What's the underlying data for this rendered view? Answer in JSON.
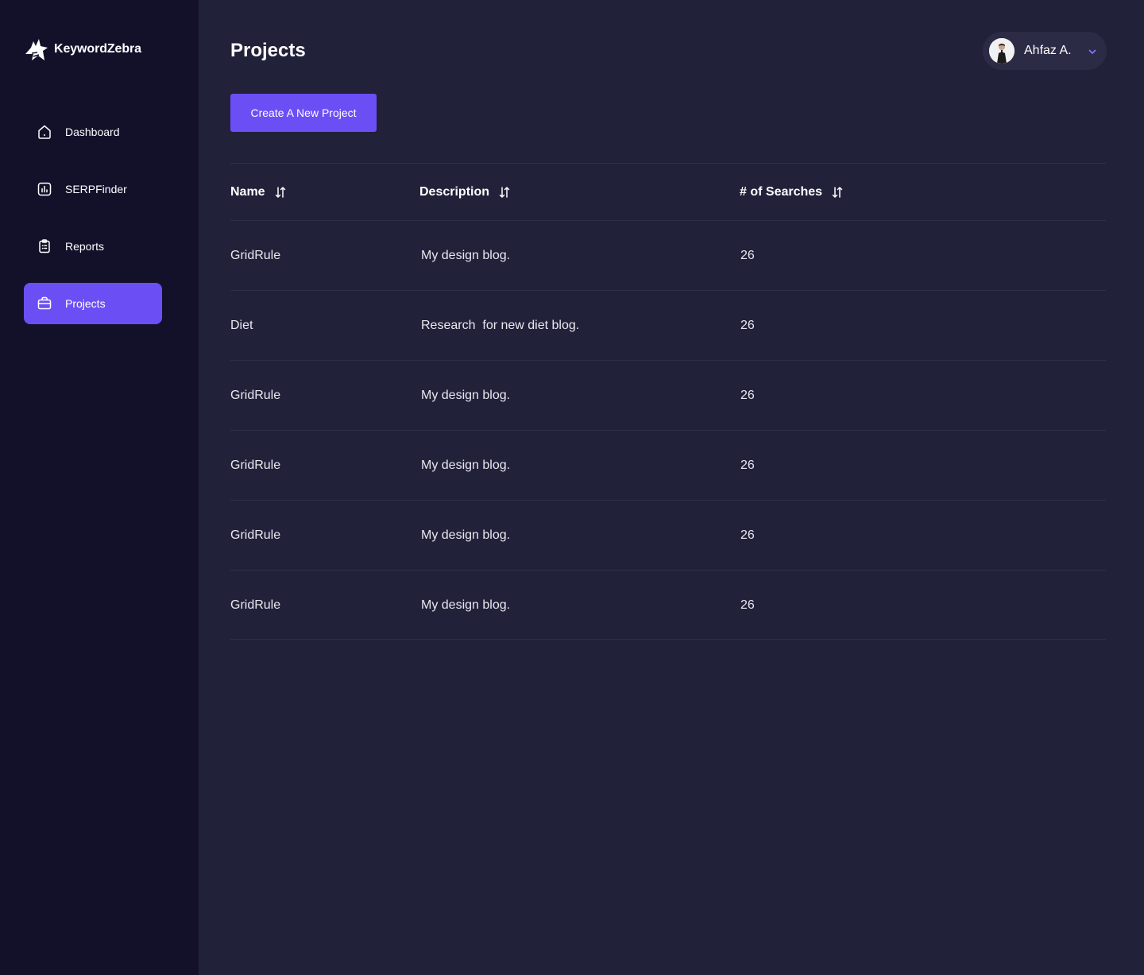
{
  "app": {
    "brand": "KeywordZebra"
  },
  "sidebar": {
    "items": [
      {
        "label": "Dashboard",
        "icon": "home-icon",
        "active": false
      },
      {
        "label": "SERPFinder",
        "icon": "bar-chart-icon",
        "active": false
      },
      {
        "label": "Reports",
        "icon": "clipboard-icon",
        "active": false
      },
      {
        "label": "Projects",
        "icon": "briefcase-icon",
        "active": true
      }
    ]
  },
  "header": {
    "title": "Projects",
    "user_name": "Ahfaz A."
  },
  "actions": {
    "create_label": "Create A New Project"
  },
  "table": {
    "columns": [
      "Name",
      "Description",
      "# of Searches"
    ],
    "rows": [
      {
        "name": "GridRule",
        "description": "My design blog.",
        "searches": "26"
      },
      {
        "name": "Diet",
        "description": "Research  for new diet blog.",
        "searches": "26"
      },
      {
        "name": "GridRule",
        "description": "My design blog.",
        "searches": "26"
      },
      {
        "name": "GridRule",
        "description": "My design blog.",
        "searches": "26"
      },
      {
        "name": "GridRule",
        "description": "My design blog.",
        "searches": "26"
      },
      {
        "name": "GridRule",
        "description": "My design blog.",
        "searches": "26"
      }
    ]
  },
  "colors": {
    "accent": "#6b4ff5",
    "sidebar_bg": "#13112a",
    "main_bg": "#22213a"
  }
}
